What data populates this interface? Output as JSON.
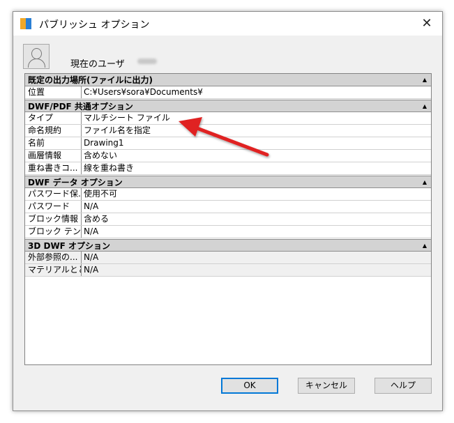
{
  "dialog": {
    "title": "パブリッシュ オプション",
    "current_user_label": "現在のユーザ"
  },
  "grid": {
    "categories": [
      {
        "title": "既定の出力場所(ファイルに出力)",
        "rows": [
          {
            "key": "位置",
            "value": "C:¥Users¥sora¥Documents¥"
          }
        ]
      },
      {
        "title": "DWF/PDF 共通オプション",
        "rows": [
          {
            "key": "タイプ",
            "value": "マルチシート ファイル"
          },
          {
            "key": "命名規約",
            "value": "ファイル名を指定"
          },
          {
            "key": "名前",
            "value": "Drawing1"
          },
          {
            "key": "画層情報",
            "value": "含めない"
          },
          {
            "key": "重ね書きコ...",
            "value": "線を重ね書き"
          }
        ]
      },
      {
        "title": "DWF データ オプション",
        "rows": [
          {
            "key": "パスワード保...",
            "value": "使用不可"
          },
          {
            "key": "パスワード",
            "value": "N/A"
          },
          {
            "key": "ブロック情報",
            "value": "含める"
          },
          {
            "key": "ブロック テン...",
            "value": "N/A"
          }
        ]
      },
      {
        "title": "3D DWF オプション",
        "rows": [
          {
            "key": "外部参照の...",
            "value": "N/A"
          },
          {
            "key": "マテリアルとと...",
            "value": "N/A"
          }
        ]
      }
    ]
  },
  "buttons": {
    "ok": "OK",
    "cancel": "キャンセル",
    "help": "ヘルプ"
  },
  "icons": {
    "close": "close-icon",
    "collapse": "collapse-arrow-icon",
    "user": "user-avatar-icon"
  },
  "colors": {
    "annotation_arrow": "#e02020",
    "ok_border": "#0078d7"
  }
}
